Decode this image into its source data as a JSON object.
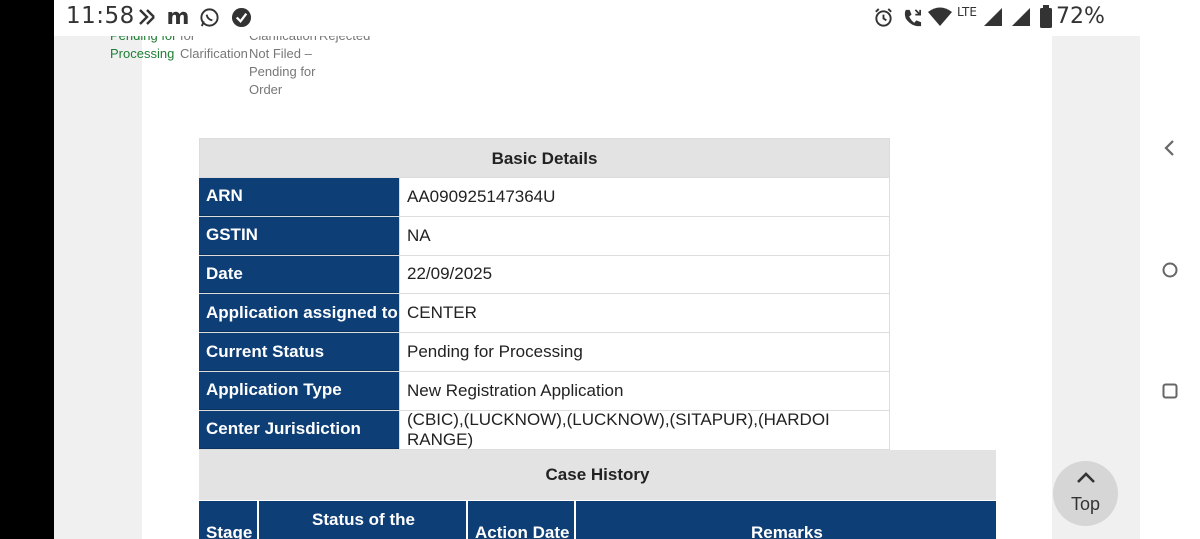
{
  "status_bar": {
    "time": "11:58",
    "network": "LTE",
    "battery": "72%"
  },
  "stepper": {
    "step1_lines": [
      "Pending for",
      "Processing"
    ],
    "step2_lines": [
      "for",
      "Clarification"
    ],
    "step3_lines": [
      "Clarification",
      "Not Filed –",
      "Pending for",
      "Order"
    ],
    "step4_lines": [
      "Rejected"
    ]
  },
  "basic_details": {
    "title": "Basic Details",
    "rows": [
      {
        "label": "ARN",
        "value": "AA090925147364U"
      },
      {
        "label": "GSTIN",
        "value": "NA"
      },
      {
        "label": "Date",
        "value": "22/09/2025"
      },
      {
        "label": "Application assigned to",
        "value": "CENTER"
      },
      {
        "label": "Current Status",
        "value": "Pending for Processing"
      },
      {
        "label": "Application Type",
        "value": "New Registration Application"
      },
      {
        "label": "Center Jurisdiction",
        "value": "(CBIC),(LUCKNOW),(LUCKNOW),(SITAPUR),(HARDOI RANGE)"
      }
    ]
  },
  "case_history": {
    "title": "Case History",
    "columns": [
      "Stage",
      "Status of the",
      "Action Date",
      "Remarks"
    ]
  },
  "top_button": {
    "label": "Top"
  },
  "colors": {
    "header_blue": "#0d3e76",
    "green_status": "#1e7e34",
    "title_gray": "#e3e3e3"
  }
}
